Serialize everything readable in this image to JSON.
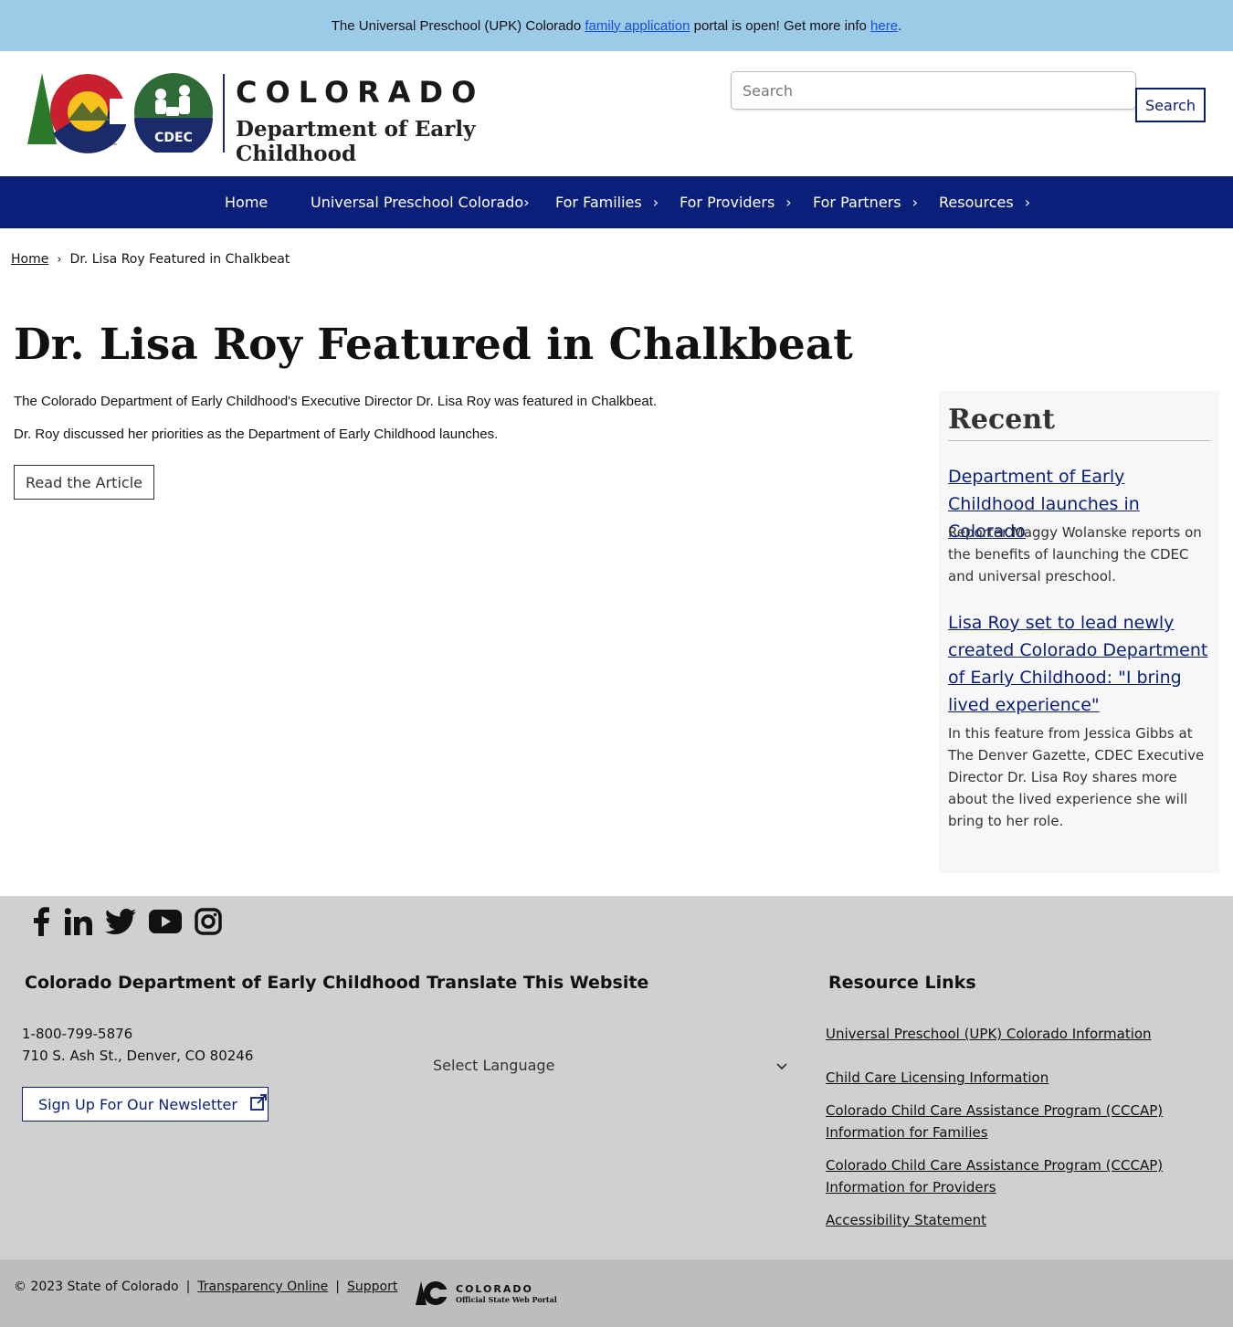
{
  "alert": {
    "text_before": "The Universal Preschool (UPK) Colorado ",
    "link1": "family application",
    "text_middle": " portal is open! Get more info ",
    "link2": "here",
    "text_after": "."
  },
  "header": {
    "brand_title": "COLORADO",
    "brand_subtitle": "Department of Early Childhood",
    "logo_badge": "CDEC",
    "search_placeholder": "Search",
    "search_button": "Search"
  },
  "nav": {
    "items": [
      {
        "label": "Home",
        "has_submenu": false
      },
      {
        "label": "Universal Preschool Colorado",
        "has_submenu": true
      },
      {
        "label": "For Families",
        "has_submenu": true
      },
      {
        "label": "For Providers",
        "has_submenu": true
      },
      {
        "label": "For Partners",
        "has_submenu": true
      },
      {
        "label": "Resources",
        "has_submenu": true
      }
    ]
  },
  "breadcrumb": {
    "home": "Home",
    "current": "Dr. Lisa Roy Featured in Chalkbeat"
  },
  "main": {
    "title": "Dr. Lisa Roy Featured in Chalkbeat",
    "paragraphs": [
      "The Colorado Department of Early Childhood's Executive Director Dr. Lisa Roy was featured in Chalkbeat.",
      "Dr. Roy discussed her priorities as the Department of Early Childhood launches."
    ],
    "read_button": "Read the Article"
  },
  "sidebar": {
    "title": "Recent",
    "items": [
      {
        "title": "Department of Early Childhood launches in Colorado",
        "description": "Reporter Maggy Wolanske reports on the benefits of launching the CDEC and universal preschool."
      },
      {
        "title": "Lisa Roy set to lead newly created Colorado Department of Early Childhood: \"I bring lived experience\"",
        "description": "In this feature from Jessica Gibbs at The Denver Gazette, CDEC Executive Director Dr. Lisa Roy shares more about the lived experience she will bring to her role."
      }
    ]
  },
  "footer": {
    "social_icons": [
      "facebook-icon",
      "linkedin-icon",
      "twitter-icon",
      "youtube-icon",
      "instagram-icon"
    ],
    "org_heading": "Colorado Department of Early Childhood",
    "phone": "1-800-799-5876",
    "address": "710 S. Ash St., Denver, CO 80246",
    "newsletter_button": "Sign Up For Our Newsletter",
    "translate_heading": "Translate This Website",
    "language_select": "Select Language",
    "resources_heading": "Resource Links",
    "resource_links": [
      "Universal Preschool (UPK) Colorado Information",
      "Child Care Licensing Information",
      "Colorado Child Care Assistance Program (CCCAP) Information for Families",
      "Colorado Child Care Assistance Program (CCCAP) Information for Providers",
      "Accessibility Statement"
    ]
  },
  "bottom": {
    "copyright": "© 2023 State of Colorado",
    "sep": "|",
    "transparency": "Transparency Online",
    "support": "Support",
    "state_logo_title": "COLORADO",
    "state_logo_subtitle": "Official State Web Portal"
  },
  "colors": {
    "alert_bg": "#9ccbe8",
    "nav_bg": "#0a1f7a",
    "link": "#0a1f7a",
    "footer_bg": "#d0d0d0",
    "bottom_bg": "#bdbdbd"
  }
}
